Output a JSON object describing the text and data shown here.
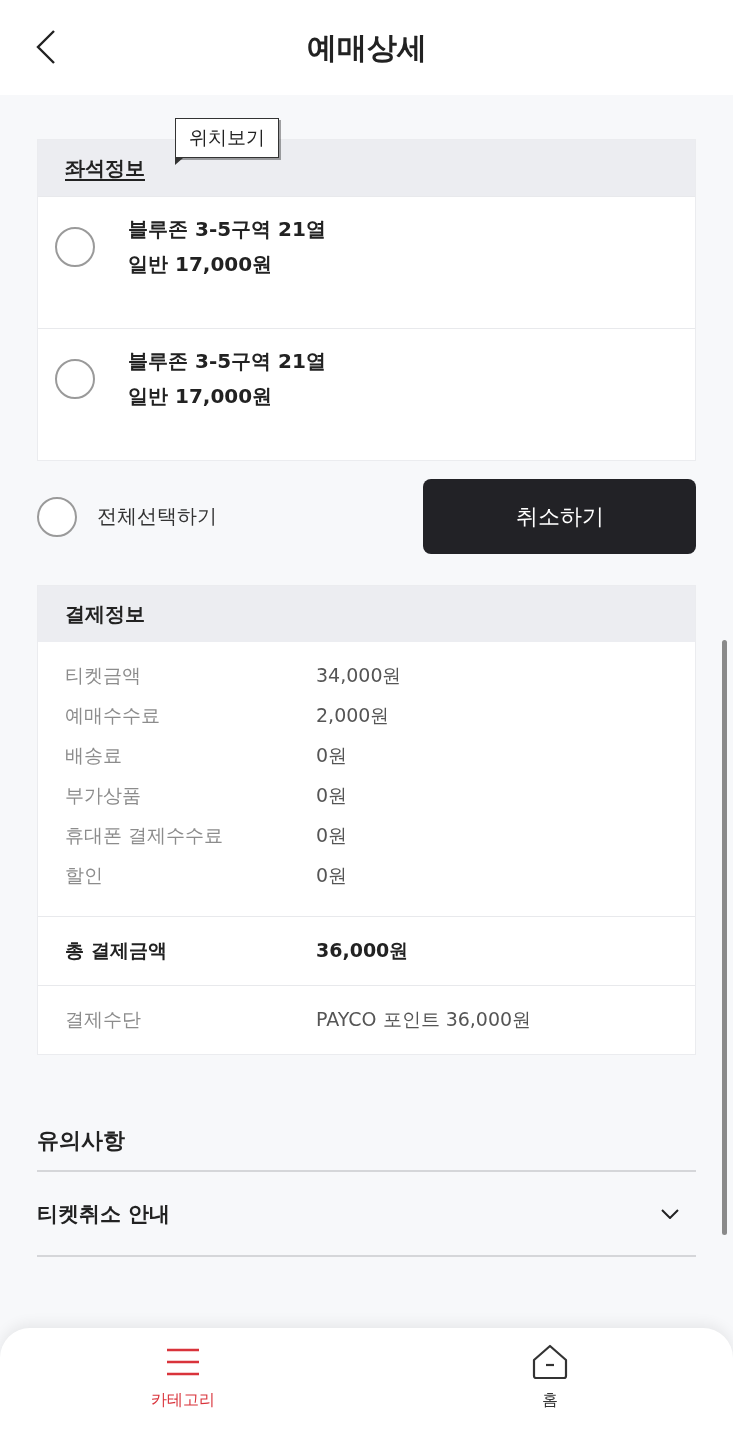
{
  "header": {
    "title": "예매상세"
  },
  "seat_info": {
    "title": "좌석정보",
    "tooltip": "위치보기",
    "seats": [
      {
        "name": "블루존 3-5구역 21열",
        "price": "일반 17,000원",
        "checked": false
      },
      {
        "name": "블루존 3-5구역 21열",
        "price": "일반 17,000원",
        "checked": false
      }
    ]
  },
  "select_all": {
    "label": "전체선택하기",
    "checked": false
  },
  "cancel_button": {
    "label": "취소하기"
  },
  "payment_info": {
    "title": "결제정보",
    "rows": [
      {
        "label": "티켓금액",
        "value": "34,000원"
      },
      {
        "label": "예매수수료",
        "value": "2,000원"
      },
      {
        "label": "배송료",
        "value": "0원"
      },
      {
        "label": "부가상품",
        "value": "0원"
      },
      {
        "label": "휴대폰 결제수수료",
        "value": "0원"
      },
      {
        "label": "할인",
        "value": "0원"
      }
    ],
    "total": {
      "label": "총 결제금액",
      "value": "36,000원"
    },
    "method": {
      "label": "결제수단",
      "value": "PAYCO 포인트 36,000원"
    }
  },
  "notice": {
    "title": "유의사항",
    "items": [
      {
        "label": "티켓취소 안내",
        "expanded": false
      }
    ]
  },
  "bottom_nav": [
    {
      "kind": "menu",
      "label": "카테고리",
      "selected": true
    },
    {
      "kind": "home",
      "label": "홈",
      "selected": false
    }
  ]
}
